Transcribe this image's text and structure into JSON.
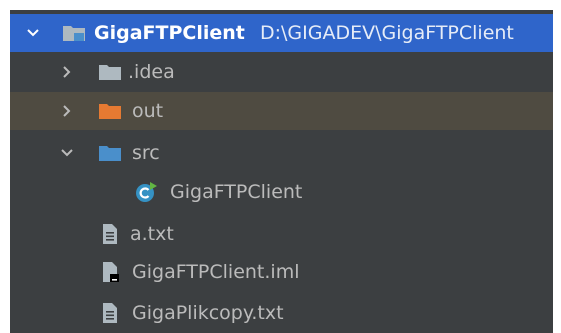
{
  "tree": {
    "root": {
      "label": "GigaFTPClient",
      "path": "D:\\GIGADEV\\GigaFTPClient",
      "icon": "module-folder-icon",
      "expanded": true
    },
    "items": [
      {
        "label": ".idea",
        "icon": "folder-icon",
        "expanded": false
      },
      {
        "label": "out",
        "icon": "excluded-folder-icon",
        "expanded": false
      },
      {
        "label": "src",
        "icon": "source-folder-icon",
        "expanded": true
      },
      {
        "label": "GigaFTPClient",
        "icon": "java-class-icon"
      },
      {
        "label": "a.txt",
        "icon": "text-file-icon"
      },
      {
        "label": "GigaFTPClient.iml",
        "icon": "iml-file-icon"
      },
      {
        "label": "GigaPlikcopy.txt",
        "icon": "text-file-icon"
      }
    ]
  },
  "colors": {
    "panel_bg": "#3c3f41",
    "selection_bg": "#2f65ca",
    "highlight_bg": "#4f4b41",
    "text": "#bbbbbb",
    "folder_gray": "#aeb9c0",
    "folder_orange": "#e67a32",
    "folder_blue": "#4a8fcb",
    "class_icon": "#3592c4",
    "run_badge": "#62b543"
  }
}
